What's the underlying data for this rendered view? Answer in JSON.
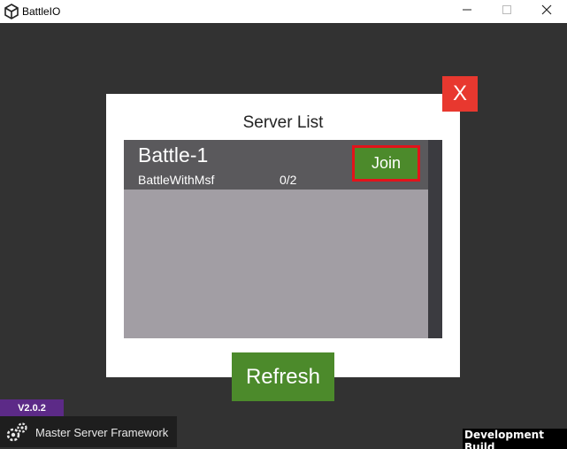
{
  "window": {
    "title": "BattleIO",
    "app_icon": "unity-logo-icon",
    "controls": [
      "minimize-icon",
      "maximize-icon",
      "close-icon"
    ]
  },
  "dialog": {
    "title": "Server List",
    "close_label": "X",
    "servers": [
      {
        "name": "Battle-1",
        "map": "BattleWithMsf",
        "players": "0/2",
        "join_label": "Join"
      }
    ],
    "refresh_label": "Refresh"
  },
  "footer": {
    "version": "V2.0.2",
    "brand_name": "Master Server Framework",
    "brand_icon": "gears-icon",
    "dev_build_label": "Development Build"
  },
  "colors": {
    "background": "#323232",
    "panel": "#ffffff",
    "list": "#a29ea4",
    "row": "#5a595c",
    "button_green": "#4c8a2b",
    "join_border": "#e3131b",
    "close_red": "#e8382f",
    "version_purple": "#5c2a87"
  }
}
